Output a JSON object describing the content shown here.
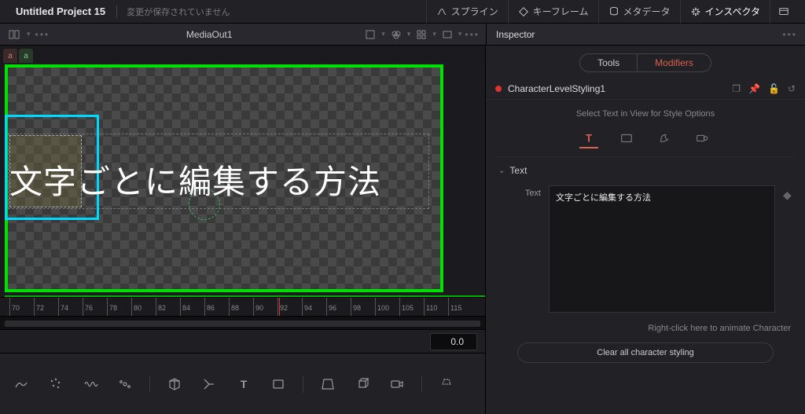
{
  "titlebar": {
    "project": "Untitled Project 15",
    "unsaved": "変更が保存されていません",
    "buttons": {
      "spline": "スプライン",
      "keyframes": "キーフレーム",
      "metadata": "メタデータ",
      "inspector": "インスペクタ"
    }
  },
  "subheader": {
    "viewer_label": "MediaOut1",
    "inspector_label": "Inspector"
  },
  "viewer": {
    "text": "文字ごとに編集する方法",
    "ruler_ticks": [
      "70",
      "72",
      "74",
      "76",
      "78",
      "80",
      "82",
      "84",
      "86",
      "88",
      "90",
      "92",
      "94",
      "96",
      "98",
      "100",
      "105",
      "110",
      "115"
    ],
    "time": "0.0"
  },
  "inspector": {
    "tabs": {
      "tools": "Tools",
      "modifiers": "Modifiers"
    },
    "node_name": "CharacterLevelStyling1",
    "hint": "Select Text in View for Style Options",
    "section": "Text",
    "text_label": "Text",
    "text_value": "文字ごとに編集する方法",
    "anim_hint": "Right-click here to animate Character",
    "clear": "Clear all character styling"
  }
}
